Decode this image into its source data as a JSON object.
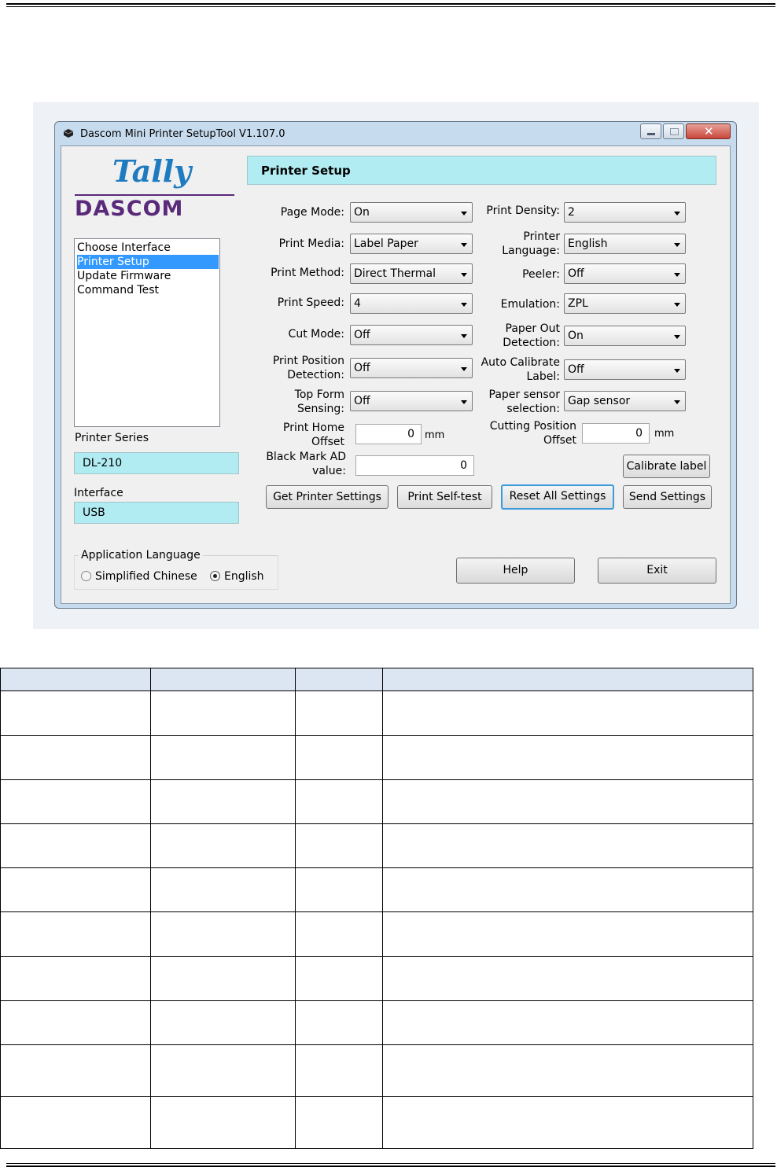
{
  "window": {
    "title": "Dascom Mini Printer SetupTool V1.107.0"
  },
  "brand": {
    "tally_text": "Tally",
    "dascom_text": "DASCOM",
    "tally_color": "#1f7bbf",
    "dascom_color": "#5a2a7a"
  },
  "nav": {
    "items": [
      {
        "label": "Choose Interface",
        "selected": false
      },
      {
        "label": "Printer Setup",
        "selected": true
      },
      {
        "label": "Update Firmware",
        "selected": false
      },
      {
        "label": "Command Test",
        "selected": false
      }
    ]
  },
  "printer_series": {
    "label": "Printer Series",
    "value": "DL-210"
  },
  "interface": {
    "label": "Interface",
    "value": "USB"
  },
  "app_language": {
    "legend": "Application Language",
    "options": [
      {
        "label": "Simplified Chinese",
        "selected": false
      },
      {
        "label": "English",
        "selected": true
      }
    ]
  },
  "header": {
    "title": "Printer Setup"
  },
  "settings": {
    "page_mode": {
      "label": "Page Mode:",
      "value": "On"
    },
    "print_media": {
      "label": "Print Media:",
      "value": "Label Paper"
    },
    "print_method": {
      "label": "Print Method:",
      "value": "Direct Thermal"
    },
    "print_speed": {
      "label": "Print Speed:",
      "value": "4"
    },
    "cut_mode": {
      "label": "Cut Mode:",
      "value": "Off"
    },
    "print_position_detection": {
      "label_1": "Print Position",
      "label_2": "Detection:",
      "value": "Off"
    },
    "top_form_sensing": {
      "label_1": "Top Form",
      "label_2": "Sensing:",
      "value": "Off"
    },
    "print_density": {
      "label": "Print Density:",
      "value": "2"
    },
    "printer_language": {
      "label_1": "Printer",
      "label_2": "Language:",
      "value": "English"
    },
    "peeler": {
      "label": "Peeler:",
      "value": "Off"
    },
    "emulation": {
      "label": "Emulation:",
      "value": "ZPL"
    },
    "paper_out_detection": {
      "label_1": "Paper Out",
      "label_2": "Detection:",
      "value": "On"
    },
    "auto_calibrate_label": {
      "label_1": "Auto Calibrate",
      "label_2": "Label:",
      "value": "Off"
    },
    "paper_sensor_selection": {
      "label_1": "Paper sensor",
      "label_2": "selection:",
      "value": "Gap sensor"
    },
    "print_home_offset": {
      "label_1": "Print Home",
      "label_2": "Offset",
      "value": "0",
      "unit": "mm"
    },
    "cutting_position_offset": {
      "label_1": "Cutting Position",
      "label_2": "Offset",
      "value": "0",
      "unit": "mm"
    },
    "black_mark_ad": {
      "label_1": "Black Mark AD",
      "label_2": "value:",
      "value": "0"
    }
  },
  "buttons": {
    "calibrate_label": "Calibrate label",
    "get_printer_settings": "Get Printer Settings",
    "print_self_test": "Print Self-test",
    "reset_all_settings": "Reset All Settings",
    "send_settings": "Send Settings",
    "help": "Help",
    "exit": "Exit"
  },
  "colors": {
    "accent_band": "#b1ecf3",
    "selection": "#3399ff",
    "close_button": "#c9463d",
    "table_header": "#dce6f2"
  }
}
